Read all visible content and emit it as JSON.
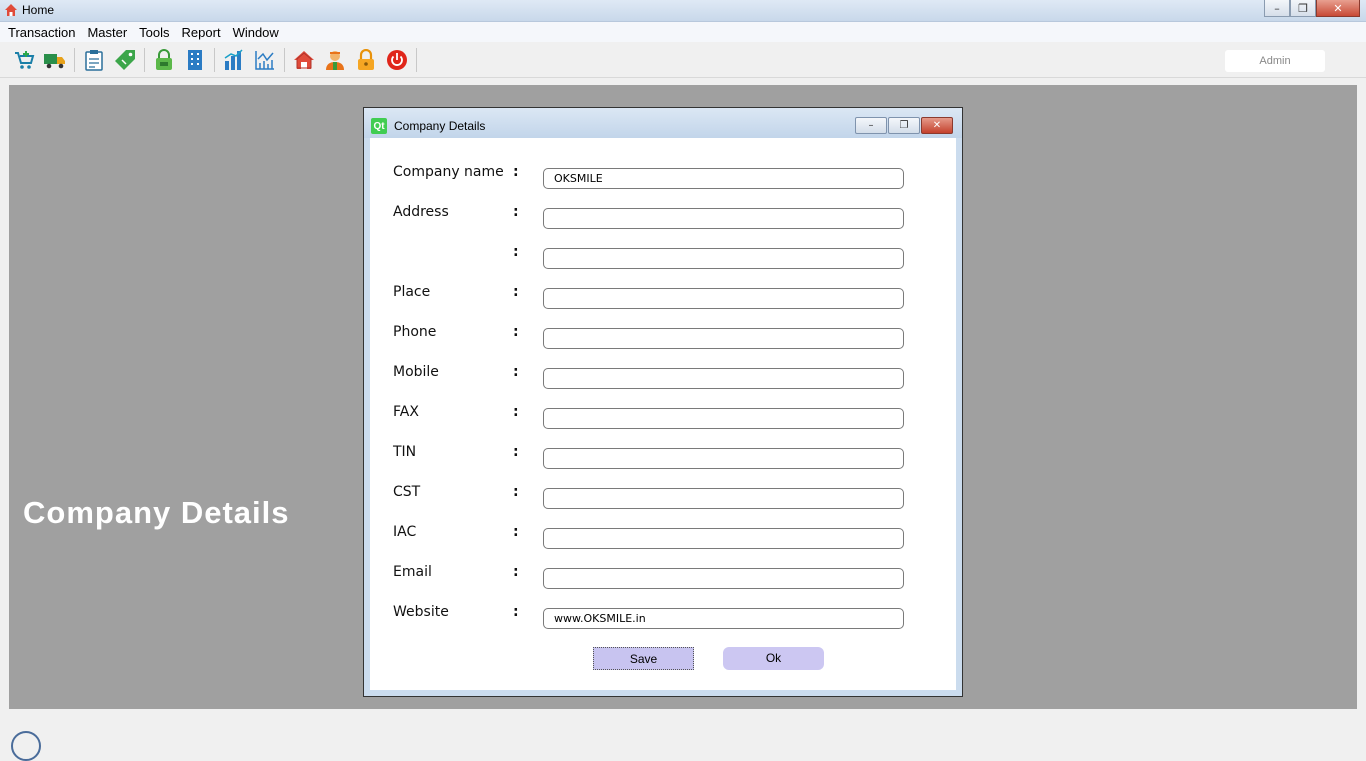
{
  "window": {
    "title": "Home",
    "minimize": "–",
    "maximize": "❐",
    "close": "✕"
  },
  "menu": [
    "Transaction",
    "Master",
    "Tools",
    "Report",
    "Window"
  ],
  "toolbar": {
    "icons": [
      "shopping-cart-icon",
      "delivery-truck-icon",
      "clipboard-icon",
      "price-tag-icon",
      "lock-bag-icon",
      "building-icon",
      "bar-chart-icon",
      "line-chart-icon",
      "home-icon",
      "user-icon",
      "padlock-icon",
      "power-icon"
    ],
    "user": "Admin"
  },
  "mdi": {
    "caption": "Company Details"
  },
  "dialog": {
    "title": "Company Details",
    "qt_badge": "Qt",
    "fields": [
      {
        "label": "Company name",
        "value": "OKSMILE"
      },
      {
        "label": "Address",
        "value": ""
      },
      {
        "label": "",
        "value": ""
      },
      {
        "label": "Place",
        "value": ""
      },
      {
        "label": "Phone",
        "value": ""
      },
      {
        "label": "Mobile",
        "value": ""
      },
      {
        "label": "FAX",
        "value": ""
      },
      {
        "label": "TIN",
        "value": ""
      },
      {
        "label": "CST",
        "value": ""
      },
      {
        "label": "IAC",
        "value": ""
      },
      {
        "label": "Email",
        "value": ""
      },
      {
        "label": "Website",
        "value": "www.OKSMILE.in"
      }
    ],
    "colon": ":",
    "save_label": "Save",
    "ok_label": "Ok"
  },
  "colors": {
    "mdi_background": "#a0a0a0",
    "button_fill": "#c8c4f0",
    "qt_green": "#41cd52"
  }
}
